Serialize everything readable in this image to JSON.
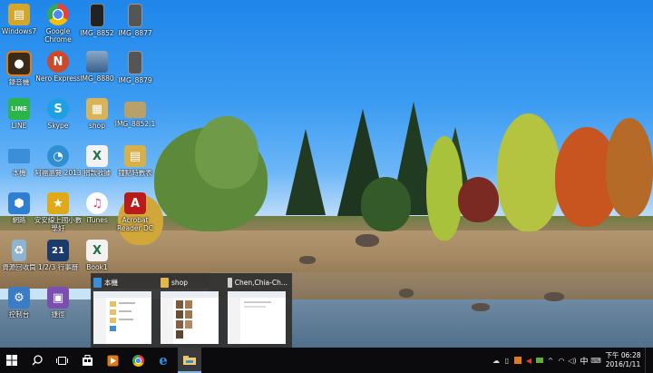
{
  "desktop": {
    "icons": [
      {
        "label": "Windows7",
        "color": "#d4a62a"
      },
      {
        "label": "Google Chrome",
        "color": "#e84437"
      },
      {
        "label": "IMG_8852",
        "color": "#222222"
      },
      {
        "label": "IMG_8877",
        "color": "#444444"
      },
      {
        "label": "錄音機",
        "color": "#e07b18"
      },
      {
        "label": "Nero Express",
        "color": "#cc4a2a"
      },
      {
        "label": "IMG_8880",
        "color": "#3a5f8a"
      },
      {
        "label": "IMG_8879",
        "color": "#555555"
      },
      {
        "label": "LINE",
        "color": "#2ab548"
      },
      {
        "label": "Skype",
        "color": "#1fa0e3"
      },
      {
        "label": "shop",
        "color": "#d9b35a"
      },
      {
        "label": "IMG_8852.1",
        "color": "#b8a06a"
      },
      {
        "label": "本機",
        "color": "#3b8fd8"
      },
      {
        "label": "阿福瀏覽 2013",
        "color": "#2f8fd0"
      },
      {
        "label": "捐款收據",
        "color": "#7aa65a"
      },
      {
        "label": "鐘點時數表",
        "color": "#d6b04a"
      },
      {
        "label": "網路",
        "color": "#2e7fd1"
      },
      {
        "label": "安安線上國小數學好",
        "color": "#e0a91c"
      },
      {
        "label": "iTunes",
        "color": "#d5427a"
      },
      {
        "label": "Acrobat Reader DC",
        "color": "#b91b1b"
      },
      {
        "label": "資源回收筒",
        "color": "#8fb4d0"
      },
      {
        "label": "1/2/3 行事曆",
        "color": "#1c3b6d"
      },
      {
        "label": "Book1",
        "color": "#207245"
      },
      {
        "label": "控制台",
        "color": "#3b7cc6"
      },
      {
        "label": "捷徑",
        "color": "#7a4fb0"
      }
    ]
  },
  "preview": {
    "windows": [
      {
        "title": "本機",
        "icon_color": "#3b8fd8"
      },
      {
        "title": "shop",
        "icon_color": "#e2b84a"
      },
      {
        "title": "Chen,Chia-Ch...",
        "icon_color": "#cfcfcf"
      }
    ]
  },
  "taskbar": {
    "apps": [
      {
        "name": "start-button",
        "icon": "windows-logo-icon"
      },
      {
        "name": "search-button",
        "icon": "search-icon"
      },
      {
        "name": "task-view-button",
        "icon": "task-view-icon"
      },
      {
        "name": "store-button",
        "icon": "store-icon"
      },
      {
        "name": "media-player-button",
        "icon": "media-player-icon"
      },
      {
        "name": "chrome-button",
        "icon": "chrome-icon"
      },
      {
        "name": "edge-button",
        "icon": "edge-icon"
      },
      {
        "name": "file-explorer-button",
        "icon": "folder-icon"
      }
    ],
    "tray": {
      "ime_label": "中",
      "time": "下午 06:28",
      "date": "2016/1/11"
    }
  }
}
